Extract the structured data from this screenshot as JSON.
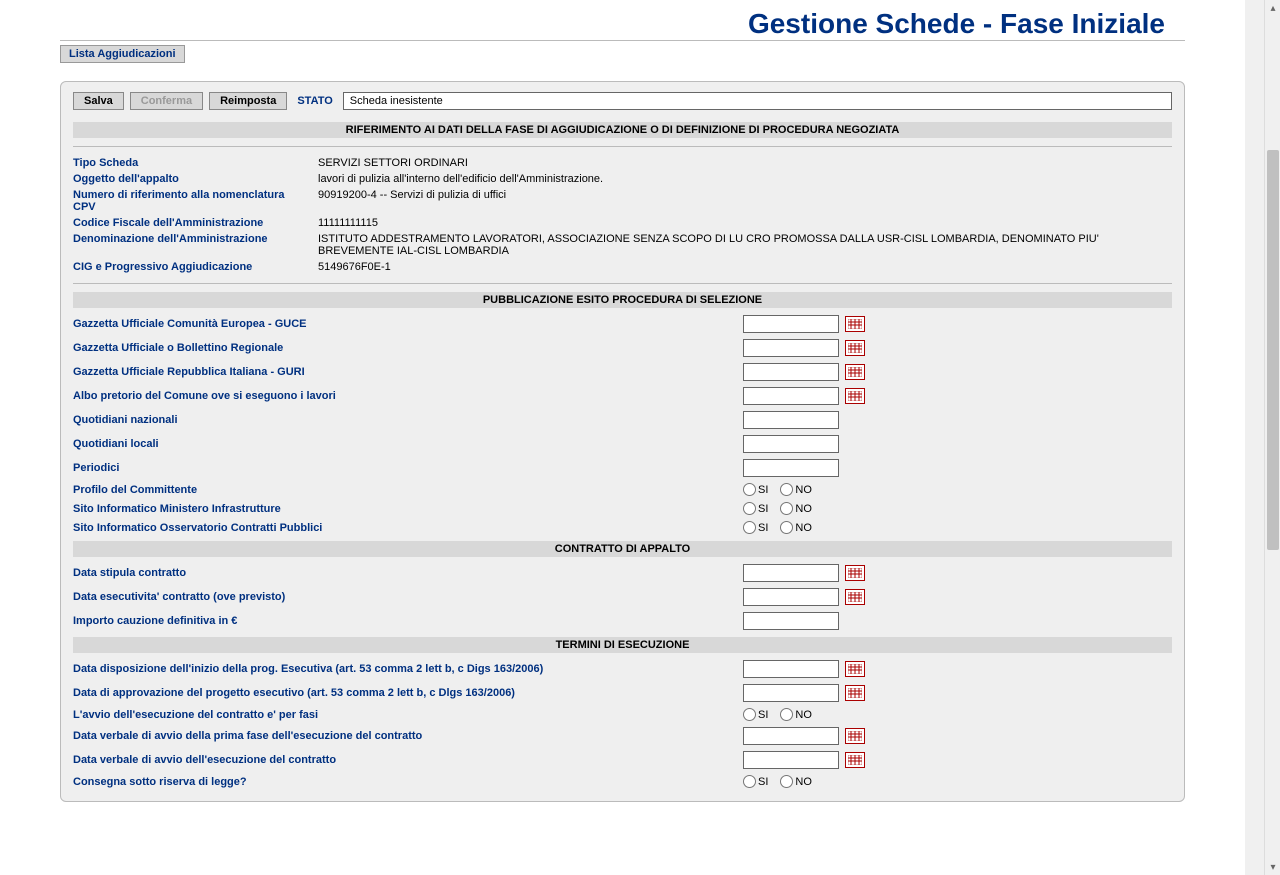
{
  "page_title": "Gestione Schede - Fase Iniziale",
  "tab": {
    "lista_aggiudicazioni": "Lista Aggiudicazioni"
  },
  "toolbar": {
    "salva": "Salva",
    "conferma": "Conferma",
    "reimposta": "Reimposta",
    "stato_label": "STATO",
    "stato_value": "Scheda inesistente"
  },
  "section1": {
    "header": "RIFERIMENTO AI DATI DELLA FASE DI AGGIUDICAZIONE O DI DEFINIZIONE DI PROCEDURA NEGOZIATA",
    "rows": [
      {
        "label": "Tipo Scheda",
        "value": "SERVIZI SETTORI ORDINARI"
      },
      {
        "label": "Oggetto dell'appalto",
        "value": "lavori di pulizia all'interno dell'edificio dell'Amministrazione."
      },
      {
        "label": "Numero di riferimento alla nomenclatura CPV",
        "value": "90919200-4 -- Servizi di pulizia di uffici"
      },
      {
        "label": "Codice Fiscale dell'Amministrazione",
        "value": "11111111115"
      },
      {
        "label": "Denominazione dell'Amministrazione",
        "value": "ISTITUTO ADDESTRAMENTO LAVORATORI, ASSOCIAZIONE SENZA SCOPO DI LU CRO PROMOSSA DALLA USR-CISL LOMBARDIA, DENOMINATO PIU' BREVEMENTE IAL-CISL LOMBARDIA"
      },
      {
        "label": "CIG e Progressivo Aggiudicazione",
        "value": "5149676F0E-1"
      }
    ]
  },
  "section2": {
    "header": "PUBBLICAZIONE ESITO PROCEDURA DI SELEZIONE",
    "fields": [
      {
        "label": "Gazzetta Ufficiale Comunità Europea - GUCE",
        "type": "date"
      },
      {
        "label": "Gazzetta Ufficiale o Bollettino Regionale",
        "type": "date"
      },
      {
        "label": "Gazzetta Ufficiale Repubblica Italiana - GURI",
        "type": "date"
      },
      {
        "label": "Albo pretorio del Comune ove si eseguono i lavori",
        "type": "date"
      },
      {
        "label": "Quotidiani nazionali",
        "type": "text"
      },
      {
        "label": "Quotidiani locali",
        "type": "text"
      },
      {
        "label": "Periodici",
        "type": "text"
      },
      {
        "label": "Profilo del Committente",
        "type": "radio"
      },
      {
        "label": "Sito Informatico Ministero Infrastrutture",
        "type": "radio"
      },
      {
        "label": "Sito Informatico Osservatorio Contratti Pubblici",
        "type": "radio"
      }
    ]
  },
  "section3": {
    "header": "CONTRATTO DI APPALTO",
    "fields": [
      {
        "label": "Data stipula contratto",
        "type": "date"
      },
      {
        "label": "Data esecutivita' contratto (ove previsto)",
        "type": "date"
      },
      {
        "label": "Importo cauzione definitiva in €",
        "type": "text"
      }
    ]
  },
  "section4": {
    "header": "TERMINI DI ESECUZIONE",
    "fields": [
      {
        "label": "Data disposizione dell'inizio della prog. Esecutiva (art. 53 comma 2 lett b, c Digs 163/2006)",
        "type": "date"
      },
      {
        "label": "Data di approvazione del progetto esecutivo (art. 53 comma 2 lett b, c Dlgs 163/2006)",
        "type": "date"
      },
      {
        "label": "L'avvio dell'esecuzione del contratto e' per fasi",
        "type": "radio"
      },
      {
        "label": "Data verbale di avvio della prima fase dell'esecuzione del contratto",
        "type": "date"
      },
      {
        "label": "Data verbale di avvio dell'esecuzione del contratto",
        "type": "date"
      },
      {
        "label": "Consegna sotto riserva di legge?",
        "type": "radio"
      }
    ]
  },
  "radio_labels": {
    "si": "SI",
    "no": "NO"
  }
}
